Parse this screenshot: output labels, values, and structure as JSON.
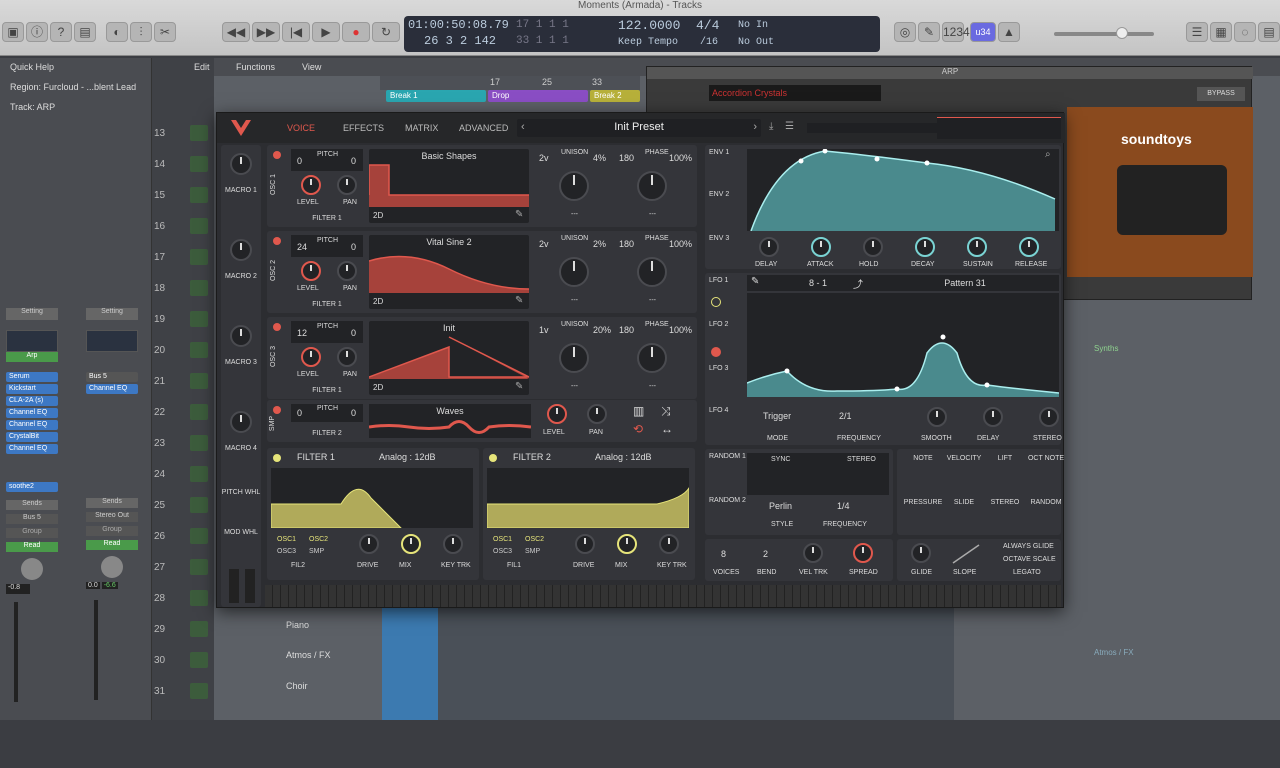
{
  "daw": {
    "title": "Moments (Armada) - Tracks",
    "lcd": {
      "time": "01:00:50:08.79",
      "bars": "26 3 2 142",
      "pos1": "17 1 1 1",
      "pos2": "33 1 1 1",
      "tempo": "122.0000",
      "tempo_mode": "Keep Tempo",
      "sig": "4/4",
      "div": "/16",
      "in": "No In",
      "out": "No Out"
    },
    "cpu": "u34",
    "menu": [
      "Edit",
      "Functions",
      "View"
    ],
    "left_rows": [
      "Quick Help",
      "Region: Furcloud - ...blent Lead",
      "Track: ARP"
    ],
    "ruler": [
      "17",
      "25",
      "33"
    ],
    "regions": [
      "Break 1",
      "Drop",
      "Break 2"
    ],
    "strip1": {
      "setting": "Setting",
      "eq": "Arp",
      "plugins": [
        "Serum",
        "Kickstart",
        "CLA-2A (s)",
        "Channel EQ",
        "Channel EQ",
        "CrystalBit",
        "Channel EQ"
      ],
      "send": "soothe2",
      "sends": "Sends",
      "bus": "Bus 5",
      "group": "Group",
      "read": "Read",
      "vol": "-0.8"
    },
    "strip2": {
      "setting": "Setting",
      "plugins": [
        "Bus 5",
        "Channel EQ"
      ],
      "sends": "Sends",
      "bus": "Stereo Out",
      "group": "Group",
      "read": "Read",
      "vol": "0.0",
      "vol2": "-6.6"
    },
    "tracks": [
      "13",
      "14",
      "15",
      "16",
      "17",
      "18",
      "19",
      "20",
      "21",
      "22",
      "23",
      "24",
      "25",
      "26",
      "27",
      "28",
      "29",
      "30",
      "31"
    ],
    "track_names": [
      "Piano",
      "Atmos / FX",
      "Choir"
    ],
    "synths_label": "Synths",
    "atmos_region": "Atmos / FX",
    "soundtoys": {
      "plugin": "Accordion Crystals",
      "brand": "soundtoys",
      "bypass": "BYPASS",
      "arp": "ARP"
    }
  },
  "vital": {
    "tabs": [
      "VOICE",
      "EFFECTS",
      "MATRIX",
      "ADVANCED"
    ],
    "preset": "Init Preset",
    "macros": [
      "MACRO 1",
      "MACRO 2",
      "MACRO 3",
      "MACRO 4"
    ],
    "pitch_whl": "PITCH WHL",
    "mod_whl": "MOD WHL",
    "oscs": [
      {
        "label": "OSC 1",
        "pitch": "0",
        "pitch_fine": "0",
        "wave": "Basic Shapes",
        "unison_v": "2v",
        "unison_pct": "4%",
        "phase": "180",
        "phase_pct": "100%",
        "filter": "FILTER 1"
      },
      {
        "label": "OSC 2",
        "pitch": "24",
        "pitch_fine": "0",
        "wave": "Vital Sine 2",
        "unison_v": "2v",
        "unison_pct": "2%",
        "phase": "180",
        "phase_pct": "100%",
        "filter": "FILTER 1"
      },
      {
        "label": "OSC 3",
        "pitch": "12",
        "pitch_fine": "0",
        "wave": "Init",
        "unison_v": "1v",
        "unison_pct": "20%",
        "phase": "180",
        "phase_pct": "100%",
        "filter": "FILTER 1"
      }
    ],
    "osc_labels": {
      "pitch": "PITCH",
      "level": "LEVEL",
      "pan": "PAN",
      "unison": "UNISON",
      "phase": "PHASE",
      "dim": "2D",
      "dash": "---"
    },
    "smp": {
      "label": "SMP",
      "pitch": "0",
      "fine": "0",
      "wave": "Waves",
      "filter": "FILTER 2",
      "level": "LEVEL",
      "pan": "PAN"
    },
    "filters": [
      {
        "name": "FILTER 1",
        "type": "Analog : 12dB",
        "srcs": [
          "OSC1",
          "OSC2",
          "OSC3",
          "SMP"
        ],
        "route": "FIL2"
      },
      {
        "name": "FILTER 2",
        "type": "Analog : 12dB",
        "srcs": [
          "OSC1",
          "OSC2",
          "OSC3",
          "SMP"
        ],
        "route": "FIL1"
      }
    ],
    "filter_knobs": [
      "DRIVE",
      "MIX",
      "KEY TRK"
    ],
    "env_tabs": [
      "ENV 1",
      "ENV 2",
      "ENV 3"
    ],
    "env_knobs": [
      "DELAY",
      "ATTACK",
      "HOLD",
      "DECAY",
      "SUSTAIN",
      "RELEASE"
    ],
    "lfo_tabs": [
      "LFO 1",
      "LFO 2",
      "LFO 3",
      "LFO 4"
    ],
    "lfo_grid": "8 - 1",
    "lfo_pattern": "Pattern 31",
    "lfo_ctrl": {
      "mode": "Trigger",
      "mode_lbl": "MODE",
      "freq": "2/1",
      "freq_lbl": "FREQUENCY",
      "k1": "SMOOTH",
      "k2": "DELAY",
      "k3": "STEREO"
    },
    "random": {
      "tabs": [
        "RANDOM 1",
        "RANDOM 2"
      ],
      "sync": "SYNC",
      "stereo": "STEREO",
      "style": "Perlin",
      "style_lbl": "STYLE",
      "freq": "1/4",
      "freq_lbl": "FREQUENCY"
    },
    "mod_sources": [
      "NOTE",
      "VELOCITY",
      "LIFT",
      "OCT NOTE",
      "PRESSURE",
      "SLIDE",
      "STEREO",
      "RANDOM"
    ],
    "voice": {
      "voices": "8",
      "voices_lbl": "VOICES",
      "bend": "2",
      "bend_lbl": "BEND",
      "veltrk": "VEL TRK",
      "spread": "SPREAD",
      "glide": "GLIDE",
      "slope": "SLOPE",
      "opts": [
        "ALWAYS GLIDE",
        "OCTAVE SCALE",
        "LEGATO"
      ]
    }
  }
}
